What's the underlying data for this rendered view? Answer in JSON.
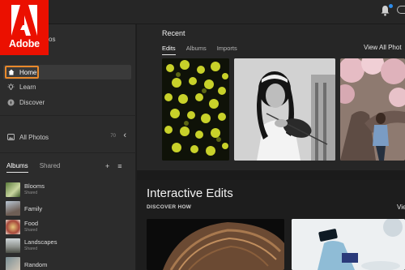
{
  "brand": {
    "name": "Adobe",
    "color": "#eb1000"
  },
  "header": {
    "notification_icon": "bell-icon",
    "profile_icon": "profile-icon"
  },
  "sidebar": {
    "app_title": "os",
    "nav": [
      {
        "label": "Home",
        "icon": "home-icon",
        "active": true
      },
      {
        "label": "Learn",
        "icon": "lightbulb-icon"
      },
      {
        "label": "Discover",
        "icon": "compass-icon"
      }
    ],
    "all_photos": {
      "label": "All Photos",
      "count": "70",
      "collapse_icon": "chevron-left-icon"
    },
    "tabs": [
      {
        "label": "Albums",
        "active": true
      },
      {
        "label": "Shared"
      }
    ],
    "tools": {
      "add": "+",
      "sort": "≡"
    },
    "albums": [
      {
        "name": "Blooms",
        "sub": "Shared"
      },
      {
        "name": "Family",
        "sub": ""
      },
      {
        "name": "Food",
        "sub": "Shared"
      },
      {
        "name": "Landscapes",
        "sub": "Shared"
      },
      {
        "name": "Random",
        "sub": ""
      }
    ]
  },
  "main": {
    "recent": {
      "title": "Recent",
      "tabs": [
        {
          "label": "Edits",
          "active": true
        },
        {
          "label": "Albums"
        },
        {
          "label": "Imports"
        }
      ],
      "view_all": "View All Phot"
    },
    "interactive": {
      "title": "Interactive Edits",
      "subtitle": "DISCOVER HOW",
      "view_link": "Vie"
    }
  },
  "colors": {
    "highlight_outline": "#e8892b",
    "accent_blue": "#2d8ceb"
  }
}
